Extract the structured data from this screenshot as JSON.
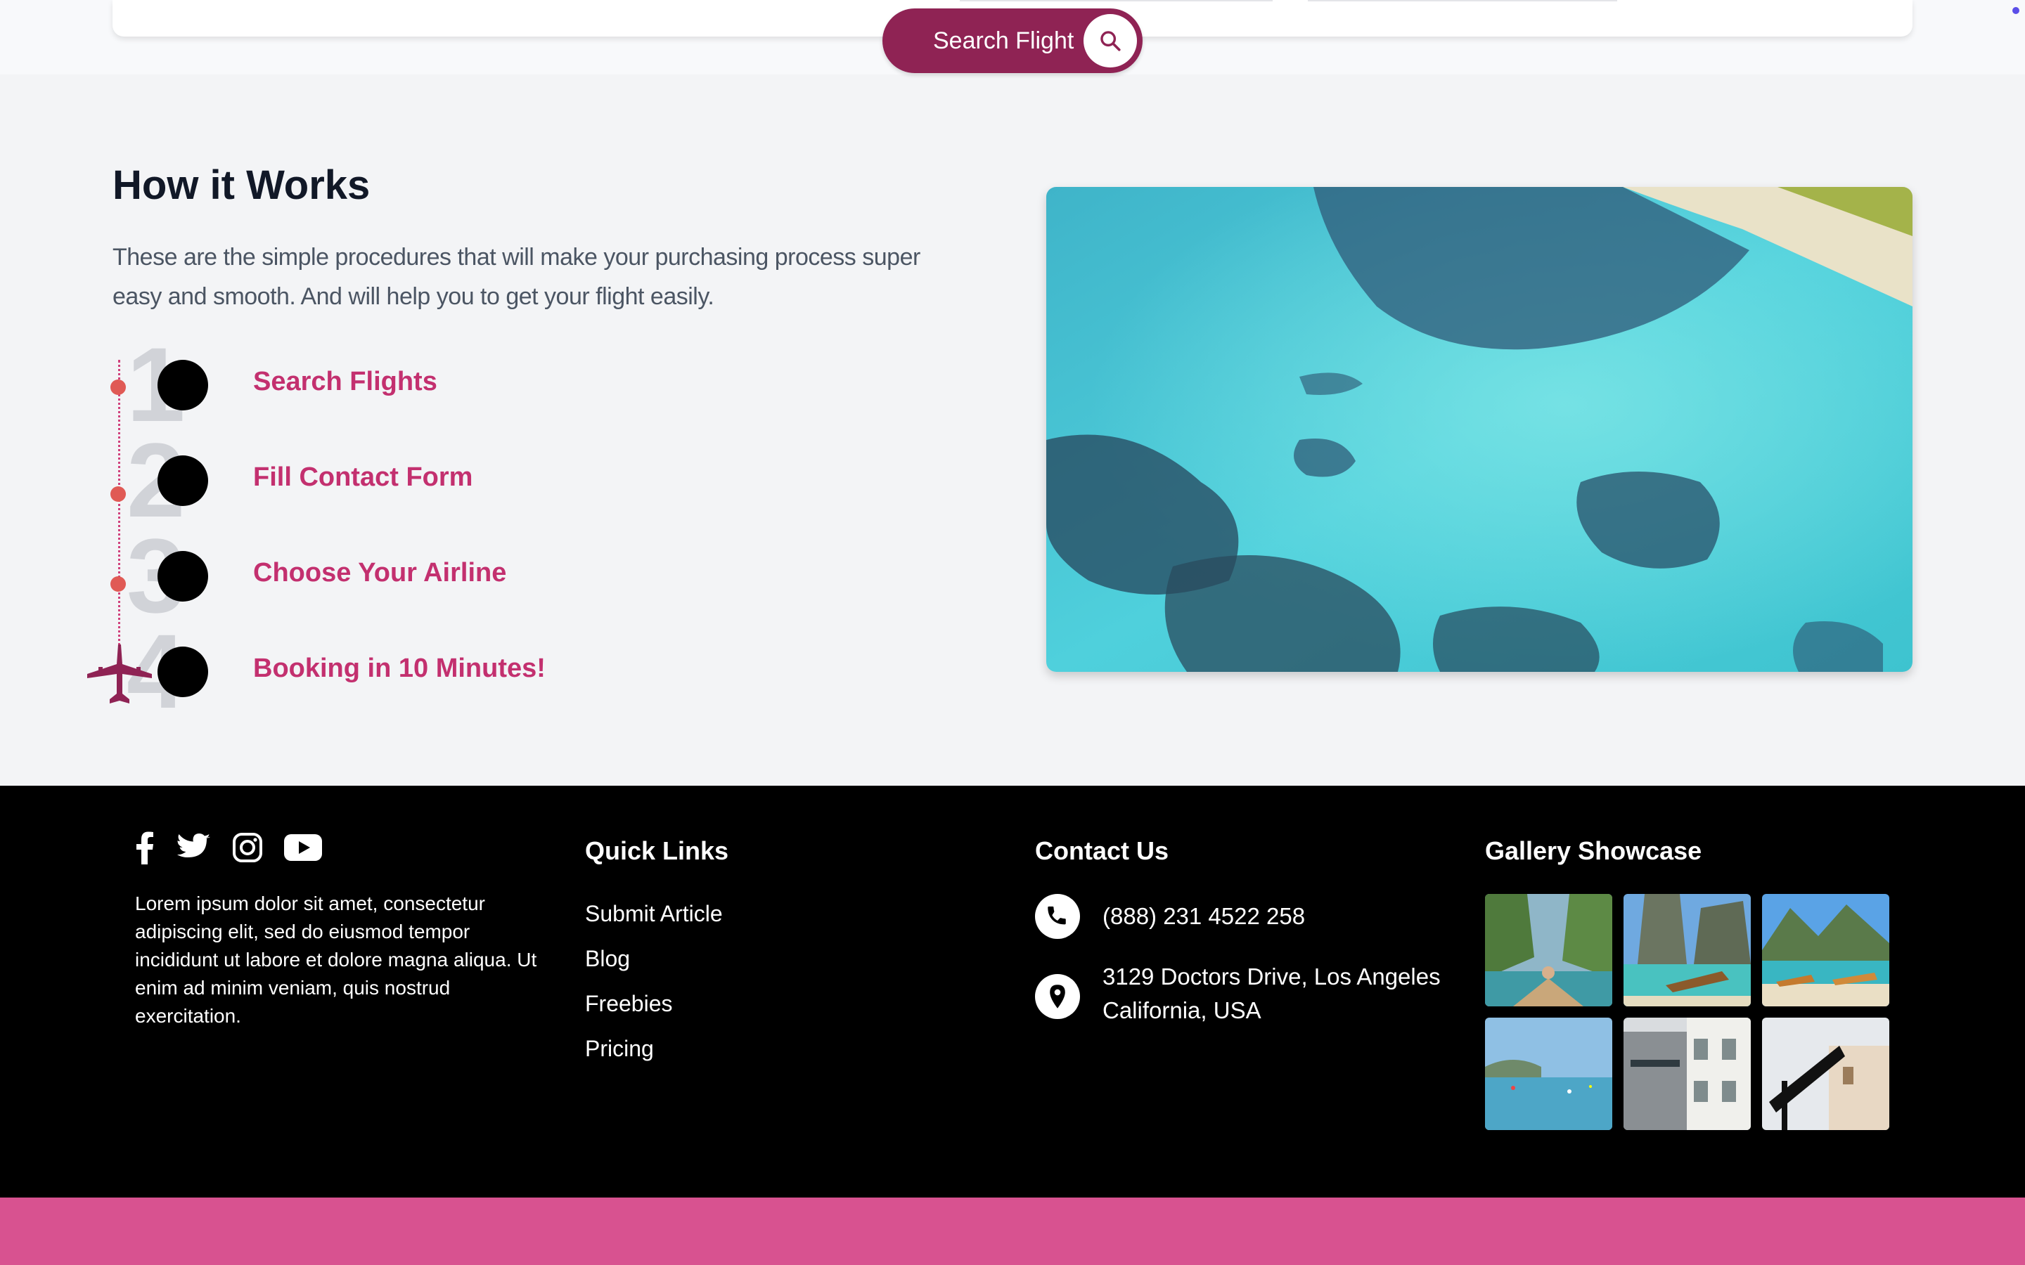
{
  "search": {
    "button_label": "Search Flight",
    "icon": "search-icon"
  },
  "how_it_works": {
    "title": "How it Works",
    "description": "These are the simple procedures that will make your purchasing process super easy and smooth. And will help you to get your flight easily.",
    "steps": [
      {
        "number": "1",
        "label": "Search Flights"
      },
      {
        "number": "2",
        "label": "Fill Contact Form"
      },
      {
        "number": "3",
        "label": "Choose Your Airline"
      },
      {
        "number": "4",
        "label": "Booking in 10 Minutes!"
      }
    ],
    "image": "aerial-beach-photo"
  },
  "footer": {
    "social_icons": [
      "facebook-icon",
      "twitter-icon",
      "instagram-icon",
      "youtube-icon"
    ],
    "about": "Lorem ipsum dolor sit amet, consectetur adipiscing elit, sed do eiusmod tempor incididunt ut labore et dolore magna aliqua. Ut enim ad minim veniam, quis nostrud exercitation.",
    "quick_links": {
      "title": "Quick Links",
      "items": [
        "Submit Article",
        "Blog",
        "Freebies",
        "Pricing"
      ]
    },
    "contact": {
      "title": "Contact Us",
      "phone": "(888) 231 4522 258",
      "address_line1": "3129 Doctors Drive, Los Angeles",
      "address_line2": "California, USA"
    },
    "gallery": {
      "title": "Gallery Showcase",
      "images": [
        "gallery-image-1",
        "gallery-image-2",
        "gallery-image-3",
        "gallery-image-4",
        "gallery-image-5",
        "gallery-image-6"
      ]
    }
  },
  "colors": {
    "brand": "#8f2354",
    "accent": "#c3306f",
    "footer_bg": "#000000",
    "bottom_bar": "#d85290"
  }
}
